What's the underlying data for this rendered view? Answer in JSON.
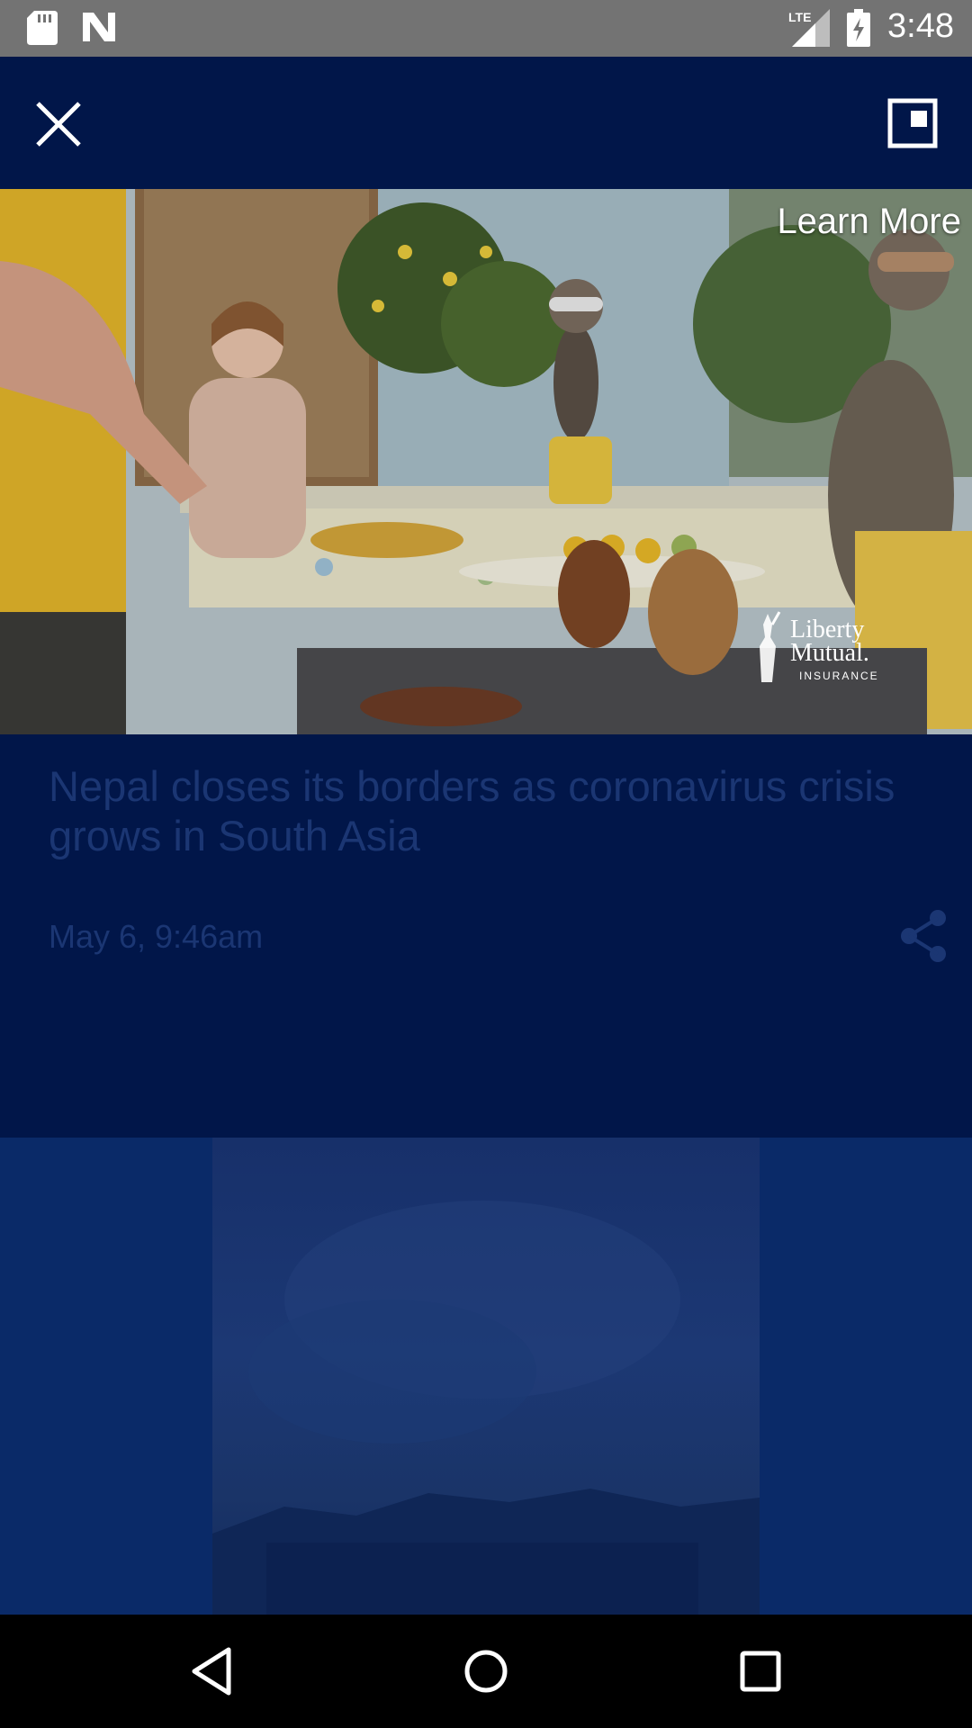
{
  "status_bar": {
    "time": "3:48",
    "network": "LTE",
    "icons": [
      "sd-card-icon",
      "n-notification-icon",
      "lte-signal-icon",
      "battery-charging-icon"
    ]
  },
  "toolbar": {
    "close_icon": "close-icon",
    "pip_icon": "picture-in-picture-icon"
  },
  "video_ad": {
    "cta": "Learn More",
    "advertiser_line1": "Liberty",
    "advertiser_line2": "Mutual.",
    "advertiser_line3": "INSURANCE"
  },
  "article": {
    "headline": "Nepal closes its borders as coronavirus crisis grows in South Asia",
    "date": "May 6, 9:46am",
    "share_icon": "share-icon"
  },
  "nav_bar": {
    "icons": [
      "back-icon",
      "home-icon",
      "recents-icon"
    ]
  },
  "colors": {
    "background": "#011649",
    "status_bar": "#737373",
    "muted_text": "#1b3673"
  }
}
